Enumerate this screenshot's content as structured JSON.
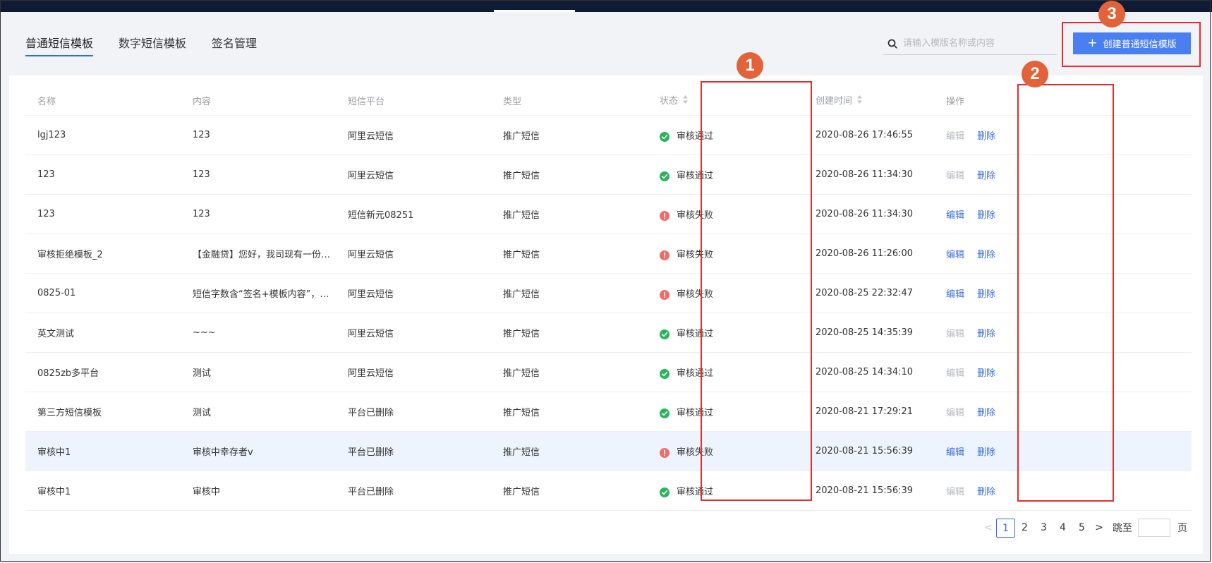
{
  "tabs": [
    {
      "label": "普通短信模板",
      "active": true
    },
    {
      "label": "数字短信模板",
      "active": false
    },
    {
      "label": "签名管理",
      "active": false
    }
  ],
  "search": {
    "placeholder": "请输入模版名称或内容",
    "value": ""
  },
  "create_button": {
    "label": "创建普通短信模版"
  },
  "table": {
    "columns": [
      "名称",
      "内容",
      "短信平台",
      "类型",
      "状态",
      "创建时间",
      "操作"
    ],
    "rows": [
      {
        "name": "lgj123",
        "content": "123",
        "platform": "阿里云短信",
        "type": "推广短信",
        "status": "审核通过",
        "status_type": "ok",
        "created": "2020-08-26 17:46:55",
        "edit": "编辑",
        "edit_enabled": false,
        "delete": "删除"
      },
      {
        "name": "123",
        "content": "123",
        "platform": "阿里云短信",
        "type": "推广短信",
        "status": "审核通过",
        "status_type": "ok",
        "created": "2020-08-26 11:34:30",
        "edit": "编辑",
        "edit_enabled": false,
        "delete": "删除"
      },
      {
        "name": "123",
        "content": "123",
        "platform": "短信新元08251",
        "type": "推广短信",
        "status": "审核失败",
        "status_type": "fail",
        "created": "2020-08-26 11:34:30",
        "edit": "编辑",
        "edit_enabled": true,
        "delete": "删除"
      },
      {
        "name": "审核拒绝模板_2",
        "content": "【金融贷】您好，我司现有一份…",
        "platform": "阿里云短信",
        "type": "推广短信",
        "status": "审核失败",
        "status_type": "fail",
        "created": "2020-08-26 11:26:00",
        "edit": "编辑",
        "edit_enabled": true,
        "delete": "删除"
      },
      {
        "name": "0825-01",
        "content": "短信字数含“签名+模板内容”，…",
        "platform": "阿里云短信",
        "type": "推广短信",
        "status": "审核失败",
        "status_type": "fail",
        "created": "2020-08-25 22:32:47",
        "edit": "编辑",
        "edit_enabled": true,
        "delete": "删除"
      },
      {
        "name": "英文测试",
        "content": "~~~",
        "platform": "阿里云短信",
        "type": "推广短信",
        "status": "审核通过",
        "status_type": "ok",
        "created": "2020-08-25 14:35:39",
        "edit": "编辑",
        "edit_enabled": false,
        "delete": "删除"
      },
      {
        "name": "0825zb多平台",
        "content": "测试",
        "platform": "阿里云短信",
        "type": "推广短信",
        "status": "审核通过",
        "status_type": "ok",
        "created": "2020-08-25 14:34:10",
        "edit": "编辑",
        "edit_enabled": false,
        "delete": "删除"
      },
      {
        "name": "第三方短信模板",
        "content": "测试",
        "platform": "平台已删除",
        "type": "推广短信",
        "status": "审核通过",
        "status_type": "ok",
        "created": "2020-08-21 17:29:21",
        "edit": "编辑",
        "edit_enabled": false,
        "delete": "删除"
      },
      {
        "name": "审核中1",
        "content": "审核中幸存者v",
        "platform": "平台已删除",
        "type": "推广短信",
        "status": "审核失败",
        "status_type": "fail",
        "created": "2020-08-21 15:56:39",
        "edit": "编辑",
        "edit_enabled": true,
        "delete": "删除",
        "highlight": true
      },
      {
        "name": "审核中1",
        "content": "审核中",
        "platform": "平台已删除",
        "type": "推广短信",
        "status": "审核通过",
        "status_type": "ok",
        "created": "2020-08-21 15:56:39",
        "edit": "编辑",
        "edit_enabled": false,
        "delete": "删除"
      }
    ]
  },
  "pagination": {
    "pages": [
      "1",
      "2",
      "3",
      "4",
      "5"
    ],
    "current": "1",
    "prev": "<",
    "next": ">",
    "jump_label": "跳至",
    "page_suffix": "页"
  },
  "annotations": [
    "1",
    "2",
    "3"
  ],
  "colors": {
    "accent": "#4a7ff1",
    "status_ok": "#27b45c",
    "status_fail": "#f26b6b",
    "annotation_box": "#e42c2c",
    "annotation_badge": "#e2633a"
  }
}
